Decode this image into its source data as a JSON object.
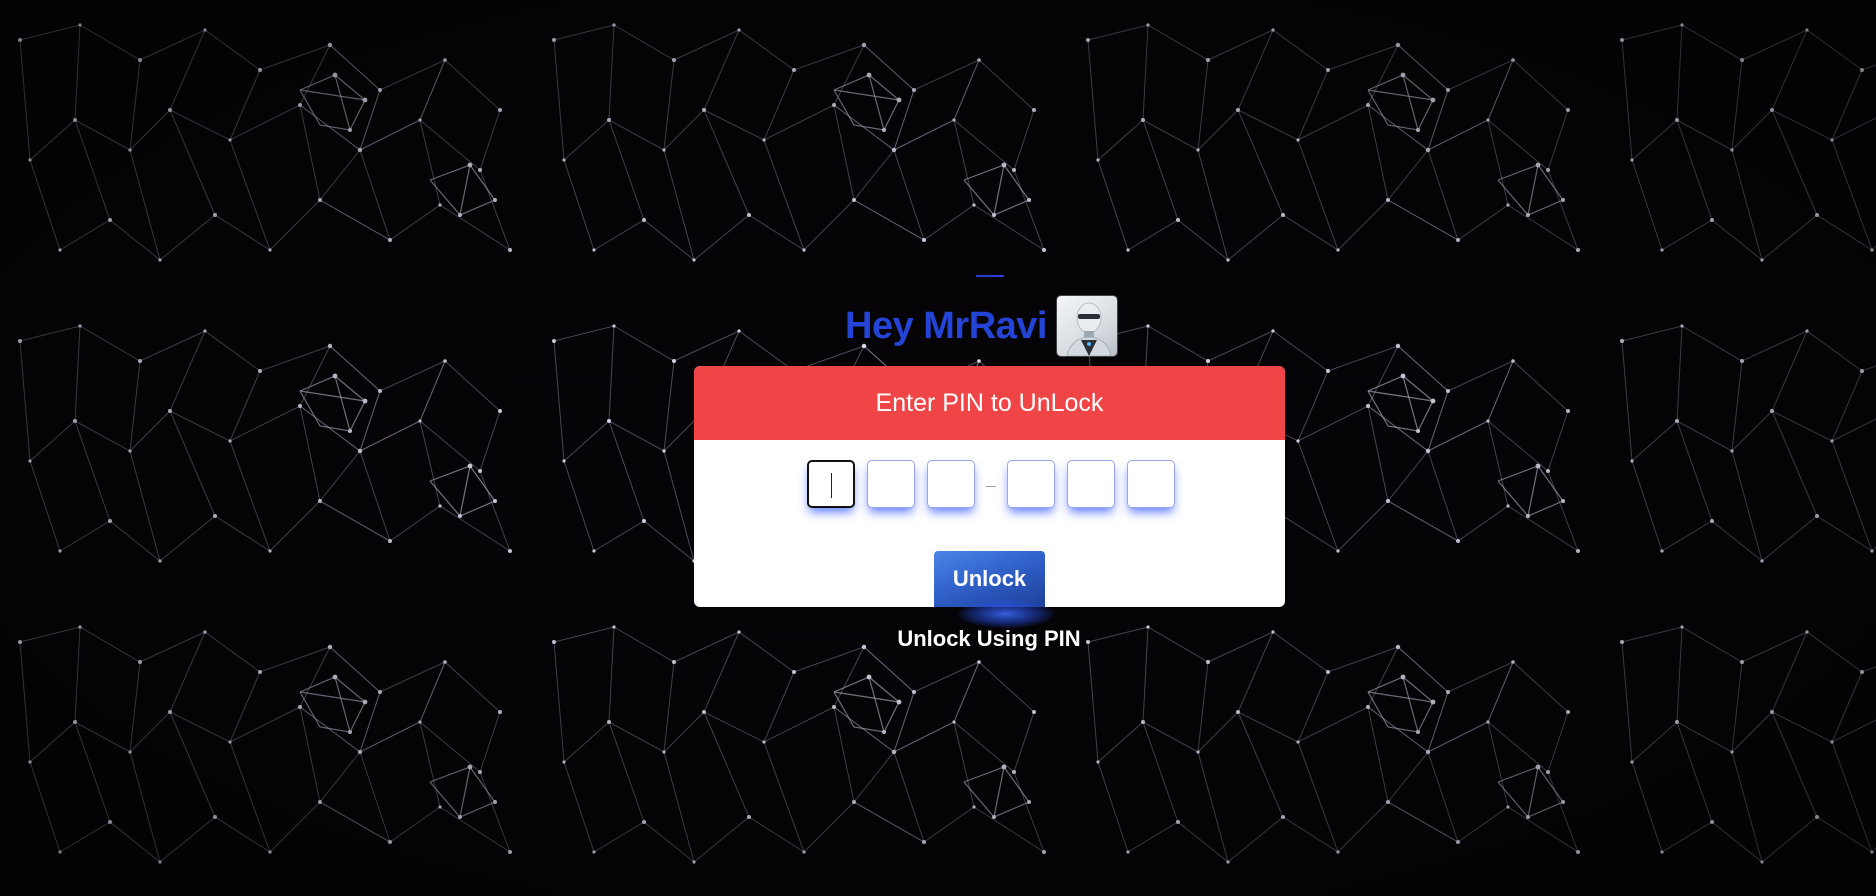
{
  "greeting": {
    "text": "Hey MrRavi",
    "avatar_icon": "robot-avatar-icon"
  },
  "card": {
    "header": "Enter PIN to UnLock",
    "pin_fields": [
      {
        "value": "",
        "active": true
      },
      {
        "value": "",
        "active": false
      },
      {
        "value": "",
        "active": false
      },
      {
        "value": "",
        "active": false
      },
      {
        "value": "",
        "active": false
      },
      {
        "value": "",
        "active": false
      }
    ],
    "unlock_button": "Unlock"
  },
  "footer": {
    "unlock_using_pin": "Unlock Using PIN"
  },
  "colors": {
    "header_red": "#ef4547",
    "greeting_blue": "#2444d8",
    "button_blue": "#2f5fc7",
    "glow_blue": "#2850ff"
  }
}
